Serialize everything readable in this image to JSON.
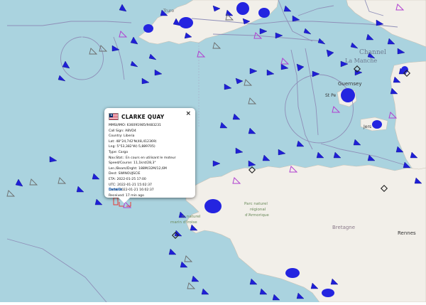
{
  "popup": {
    "ship_name": "CLARKE QUAY",
    "flag_icon": "liberia-flag-icon",
    "close_label": "×",
    "fields": [
      {
        "label": "MMSI/IMO:",
        "value": "636091985/9483231"
      },
      {
        "label": "Call Sign:",
        "value": "A8VD4"
      },
      {
        "label": "Country:",
        "value": "Liberia"
      },
      {
        "label": "Lat:",
        "value": "48°24,742'N(48,412369)"
      },
      {
        "label": "Lng:",
        "value": "5°53,382'W(-5,889705)"
      },
      {
        "label": "Type:",
        "value": "Cargo"
      },
      {
        "label": "Nav.Stat.:",
        "value": "En cours en utilisant le moteur"
      },
      {
        "label": "Speed/Course:",
        "value": "11,1knt/28,3°"
      },
      {
        "label": "Len./Beam/Drght:",
        "value": "188M/32M/12,6M"
      },
      {
        "label": "Dest:",
        "value": "SWINOUJSCIE"
      },
      {
        "label": "ETA:",
        "value": "2022-01-25 17:00"
      },
      {
        "label": "UTC:",
        "value": "2022-01-21 15:02:37"
      },
      {
        "label": "Local:",
        "value": "2022-01-21 16:02:37"
      },
      {
        "label": "Received:",
        "value": "17 min ago"
      }
    ],
    "details_label": "Details"
  },
  "map_labels": {
    "truro": "Truro",
    "guernsey": "Guernsey",
    "st_peter_port": "St Pe",
    "jersey": "Jers",
    "channel": "Channel",
    "la_manche": "La Manche",
    "park_1": "Parc naturel",
    "park_2": "régional",
    "park_3": "d'Armorique",
    "marine_1": "rc naturel",
    "marine_2": "marin d'Iroise",
    "bretagne": "Bretagne",
    "rennes": "Rennes"
  },
  "colors": {
    "sea": "#aad3df",
    "land": "#f2efe9",
    "vessel_blue": "#1f1fd6",
    "vessel_purple": "#b03fd0",
    "vessel_gray": "#7a7a7a",
    "boundary": "#8f8fb8"
  }
}
